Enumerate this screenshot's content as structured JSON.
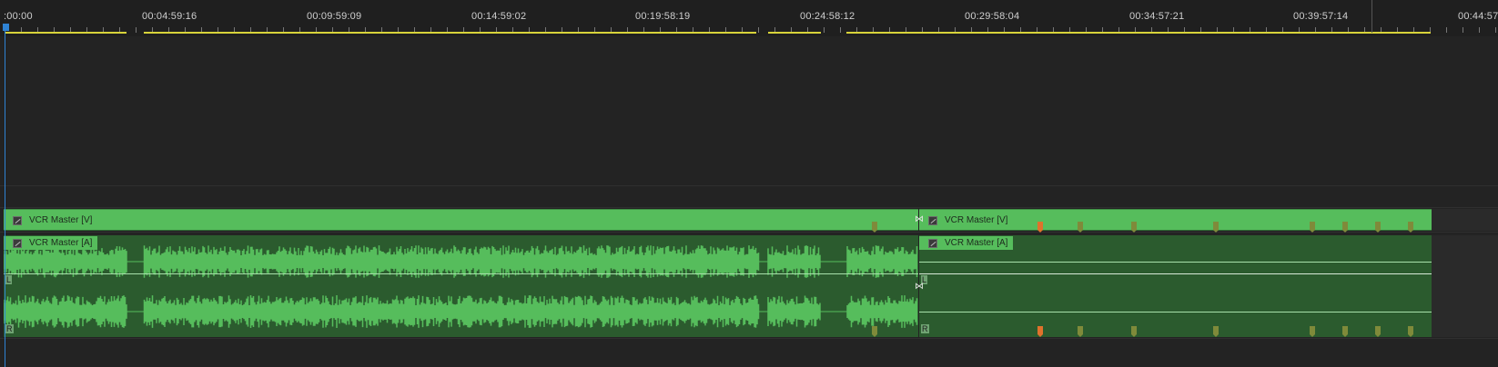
{
  "timeline": {
    "ruler": {
      "timecodes": [
        ":00:00",
        "00:04:59:16",
        "00:09:59:09",
        "00:14:59:02",
        "00:19:58:19",
        "00:24:58:12",
        "00:29:58:04",
        "00:34:57:21",
        "00:39:57:14",
        "00:44:57:"
      ]
    },
    "video_track": {
      "clips": [
        {
          "label": "VCR Master [V]"
        },
        {
          "label": "VCR Master [V]"
        }
      ]
    },
    "audio_track": {
      "clips": [
        {
          "label": "VCR Master [A]",
          "left_channel": "L",
          "right_channel": "R"
        },
        {
          "label": "VCR Master [A]",
          "left_channel": "L",
          "right_channel": "R"
        }
      ]
    },
    "colors": {
      "clip_green": "#56bd5c",
      "audio_bg": "#2b5b2e",
      "playhead": "#2f83d4",
      "work_area": "#d8d33a",
      "marker": "#7f8a3a",
      "marker_highlight": "#e0722c"
    }
  }
}
